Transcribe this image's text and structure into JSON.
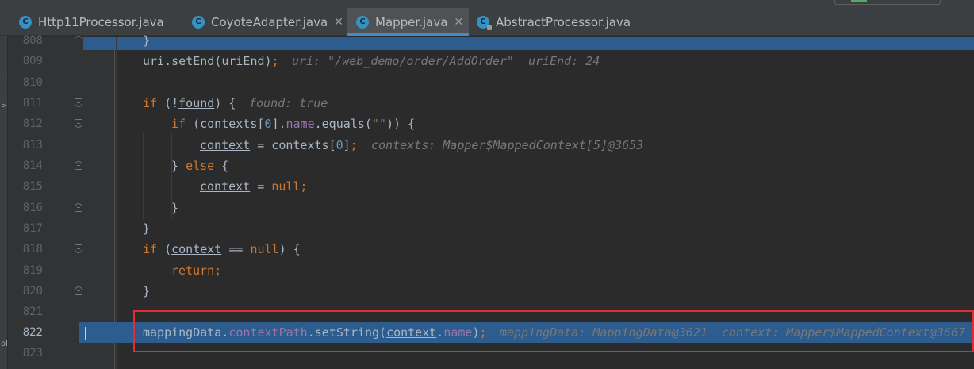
{
  "top_strip": {
    "crumb": ""
  },
  "left_strip": {
    "marks": [
      ".",
      ">",
      "ol"
    ]
  },
  "tabs": [
    {
      "label": "Http11Processor.java",
      "icon": "class-icon",
      "active": false,
      "closable": false
    },
    {
      "label": "CoyoteAdapter.java",
      "icon": "class-icon",
      "active": false,
      "closable": true
    },
    {
      "label": "Mapper.java",
      "icon": "class-icon",
      "active": true,
      "closable": true
    },
    {
      "label": "AbstractProcessor.java",
      "icon": "class-locked-icon",
      "active": false,
      "closable": false
    }
  ],
  "editor": {
    "lines": [
      {
        "no": "808",
        "code": "}"
      },
      {
        "no": "809",
        "code": "uri.setEnd(uriEnd);",
        "hint": "uri: \"/web_demo/order/AddOrder\"  uriEnd: 24"
      },
      {
        "no": "810",
        "code": ""
      },
      {
        "no": "811",
        "code": "if (!found) {",
        "hint": "found: true"
      },
      {
        "no": "812",
        "code": "if (contexts[0].name.equals(\"\")) {"
      },
      {
        "no": "813",
        "code": "context = contexts[0];",
        "hint": "contexts: Mapper$MappedContext[5]@3653"
      },
      {
        "no": "814",
        "code": "} else {"
      },
      {
        "no": "815",
        "code": "context = null;"
      },
      {
        "no": "816",
        "code": "}"
      },
      {
        "no": "817",
        "code": "}"
      },
      {
        "no": "818",
        "code": "if (context == null) {"
      },
      {
        "no": "819",
        "code": "return;"
      },
      {
        "no": "820",
        "code": "}"
      },
      {
        "no": "821",
        "code": ""
      },
      {
        "no": "822",
        "code": "mappingData.contextPath.setString(context.name);",
        "hint": "mappingData: MappingData@3621  context: Mapper$MappedContext@3667"
      },
      {
        "no": "823",
        "code": ""
      }
    ]
  },
  "colors": {
    "background": "#2b2b2b",
    "execution_line": "#2d5c8f",
    "keyword": "#cc7832",
    "field": "#9876aa",
    "string": "#6a8759",
    "inline_hint": "#787878",
    "highlight_box": "#e12b36",
    "tab_accent": "#4a88c7"
  }
}
